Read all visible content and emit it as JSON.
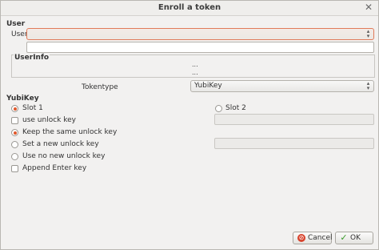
{
  "window": {
    "title": "Enroll a token",
    "close_glyph": "✕"
  },
  "user_group": {
    "title": "User",
    "user_label": "User",
    "user_value": "",
    "text_value": ""
  },
  "userinfo_group": {
    "title": "UserInfo",
    "row1": "...",
    "row2": "..."
  },
  "tokentype": {
    "label": "Tokentype",
    "value": "YubiKey"
  },
  "yubikey_group": {
    "title": "YubiKey",
    "slot1": "Slot 1",
    "slot2": "Slot 2",
    "use_unlock_key": "use unlock key",
    "keep_same": "Keep the same unlock key",
    "set_new": "Set a new unlock key",
    "use_no_new": "Use no new unlock key",
    "append_enter": "Append Enter key",
    "unlock_key_value": "",
    "new_unlock_key_value": ""
  },
  "buttons": {
    "cancel": "Cancel",
    "ok": "OK"
  },
  "icons": {
    "cancel": "cancel-icon",
    "ok": "check-icon",
    "close": "close-icon",
    "combo_arrow": "updown-arrow-icon"
  },
  "colors": {
    "accent": "#e0582c",
    "focus_border": "#e07a5a"
  }
}
